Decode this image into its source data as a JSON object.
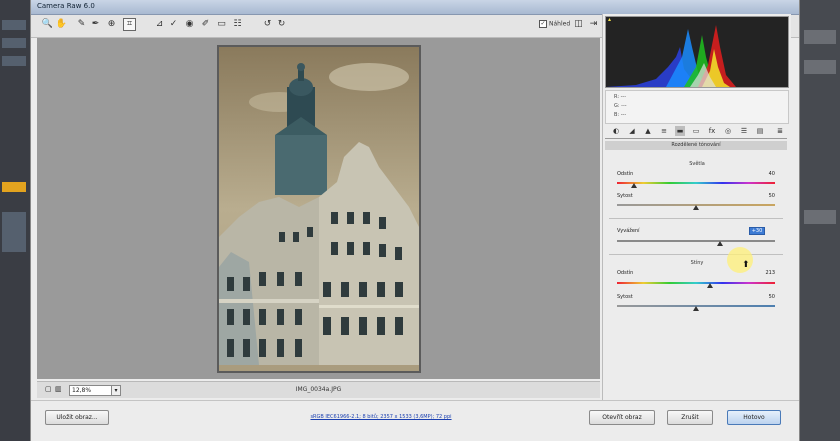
{
  "window": {
    "title": "Camera Raw 6.0"
  },
  "toolbar": {
    "tools": [
      {
        "icon": "zoom-icon",
        "glyph": "🔍"
      },
      {
        "icon": "hand-icon",
        "glyph": "✋"
      },
      {
        "icon": "white-balance-icon",
        "glyph": "✎"
      },
      {
        "icon": "color-sampler-icon",
        "glyph": "✒"
      },
      {
        "icon": "targeted-adjustment-icon",
        "glyph": "⊕"
      },
      {
        "icon": "crop-icon",
        "glyph": "⌗"
      },
      {
        "icon": "straighten-icon",
        "glyph": "⊿"
      },
      {
        "icon": "spot-removal-icon",
        "glyph": "✓"
      },
      {
        "icon": "red-eye-icon",
        "glyph": "◉"
      },
      {
        "icon": "adjustment-brush-icon",
        "glyph": "✐"
      },
      {
        "icon": "graduated-filter-icon",
        "glyph": "▭"
      },
      {
        "icon": "preferences-icon",
        "glyph": "☷"
      },
      {
        "icon": "rotate-ccw-icon",
        "glyph": "↺"
      },
      {
        "icon": "rotate-cw-icon",
        "glyph": "↻"
      }
    ],
    "preview_label": "Náhled",
    "preview_checked": true
  },
  "statusbar": {
    "zoom": "12,8%",
    "filename": "IMG_0034a.JPG"
  },
  "panel": {
    "title": "Rozdělené tónování",
    "highlights_title": "Světla",
    "highlights_hue_label": "Odstín",
    "highlights_hue_value": "40",
    "highlights_hue_level": 0.11,
    "highlights_sat_label": "Sytost",
    "highlights_sat_value": "50",
    "highlights_sat_level": 0.5,
    "balance_label": "Vyvážení",
    "balance_value": "+30",
    "balance_level": 0.65,
    "shadows_title": "Stíny",
    "shadows_hue_label": "Odstín",
    "shadows_hue_value": "213",
    "shadows_hue_level": 0.59,
    "shadows_sat_label": "Sytost",
    "shadows_sat_value": "50",
    "shadows_sat_level": 0.5
  },
  "rgb_readout": {
    "r": "R:  ---",
    "g": "G:  ---",
    "b": "B:  ---"
  },
  "bottom": {
    "save_label": "Uložit obraz...",
    "info_link": "sRGB IEC61966-2.1; 8 bitů; 2357 x 1533 (3,6MP); 72 ppi",
    "open_label": "Otevřít obraz",
    "cancel_label": "Zrušit",
    "done_label": "Hotovo"
  }
}
